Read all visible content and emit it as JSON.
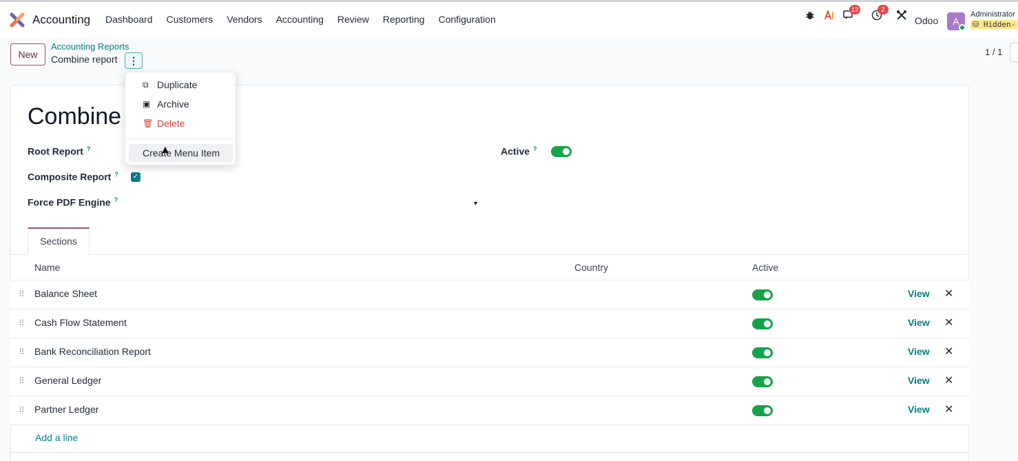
{
  "navbar": {
    "app_name": "Accounting",
    "menu": [
      "Dashboard",
      "Customers",
      "Vendors",
      "Accounting",
      "Review",
      "Reporting",
      "Configuration"
    ],
    "messages_count": "13",
    "activities_count": "2",
    "company": "Odoo",
    "avatar_letter": "A",
    "user_name": "Administrator",
    "database": "Hidden-"
  },
  "control_panel": {
    "new_label": "New",
    "breadcrumb_parent": "Accounting Reports",
    "breadcrumb_current": "Combine report",
    "pager": "1 / 1"
  },
  "action_menu": {
    "duplicate": "Duplicate",
    "archive": "Archive",
    "delete": "Delete",
    "create_menu_item": "Create Menu Item"
  },
  "form": {
    "title": "Combine",
    "root_report_label": "Root Report",
    "active_label": "Active",
    "active": true,
    "composite_label": "Composite Report",
    "composite": true,
    "pdf_engine_label": "Force PDF Engine",
    "help": "?"
  },
  "notebook": {
    "tab_sections": "Sections"
  },
  "table": {
    "headers": {
      "name": "Name",
      "country": "Country",
      "active": "Active"
    },
    "rows": [
      {
        "name": "Balance Sheet",
        "active": true,
        "view": "View"
      },
      {
        "name": "Cash Flow Statement",
        "active": true,
        "view": "View"
      },
      {
        "name": "Bank Reconciliation Report",
        "active": true,
        "view": "View"
      },
      {
        "name": "General Ledger",
        "active": true,
        "view": "View"
      },
      {
        "name": "Partner Ledger",
        "active": true,
        "view": "View"
      }
    ],
    "add_line": "Add a line"
  },
  "colors": {
    "accent": "#017e84",
    "brand": "#9f4f6f",
    "toggle_on": "#16a34a",
    "danger": "#d23f3a"
  }
}
